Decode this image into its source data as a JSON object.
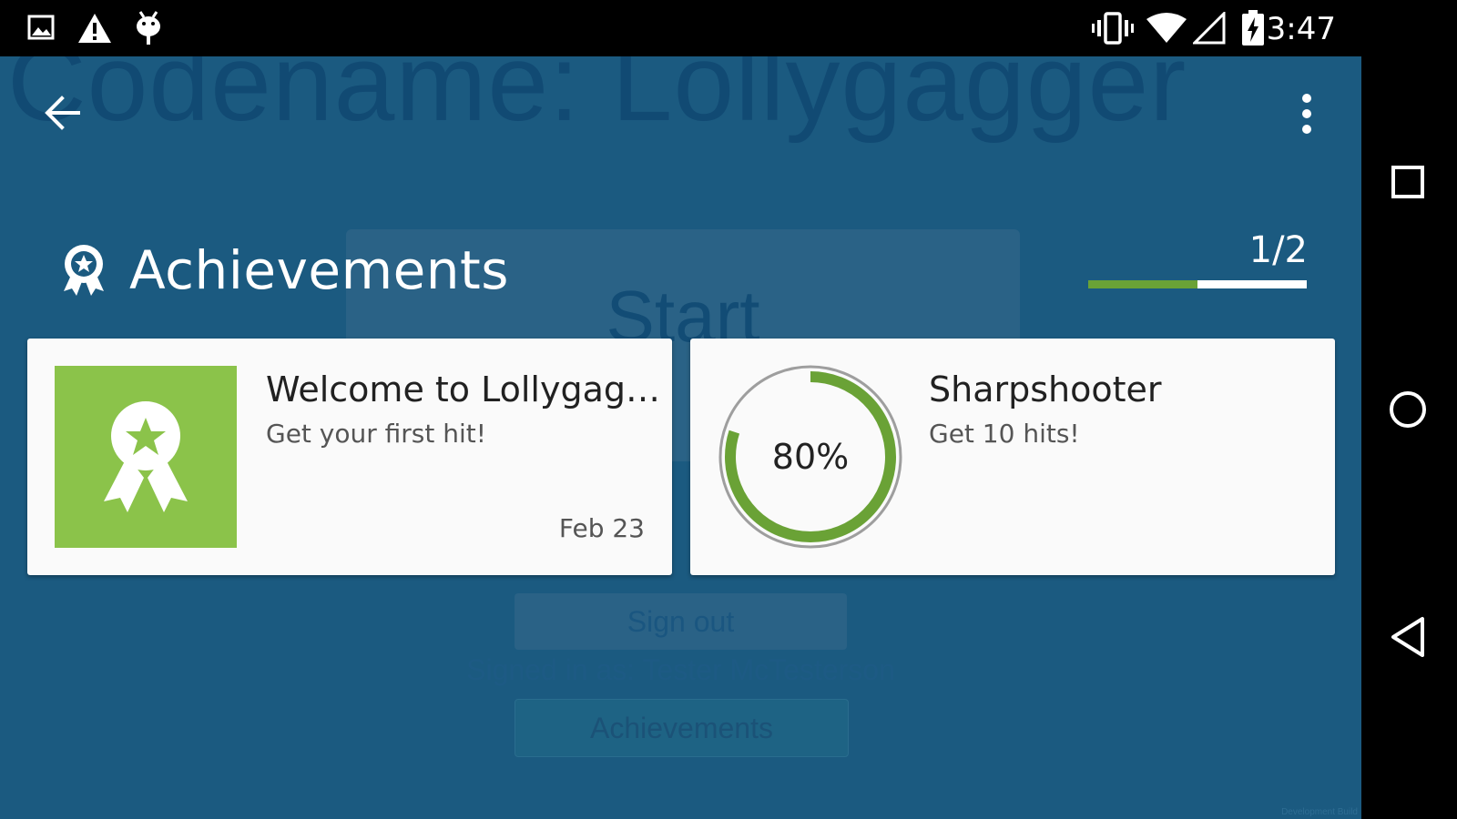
{
  "status_bar": {
    "time": "3:47",
    "left_icons": [
      "image-icon",
      "warning-icon",
      "android-debug-icon"
    ],
    "right_icons": [
      "vibrate-icon",
      "wifi-icon",
      "signal-icon",
      "battery-charging-icon"
    ]
  },
  "background": {
    "app_title": "Codename: Lollygagger",
    "start_label": "Start",
    "signout_label": "Sign out",
    "signed_in_text": "Signed in as: Tester McTesterson",
    "achievements_label": "Achievements",
    "dev_build": "Development Build"
  },
  "overlay": {
    "title": "Achievements",
    "progress_text": "1/2",
    "progress_fraction": 0.5,
    "icons": {
      "back": "back-arrow-icon",
      "menu": "overflow-menu-icon",
      "header": "award-icon"
    }
  },
  "achievements": [
    {
      "title": "Welcome to Lollygag…",
      "description": "Get your first hit!",
      "date": "Feb 23",
      "unlocked": true
    },
    {
      "title": "Sharpshooter",
      "description": "Get 10 hits!",
      "progress_label": "80%",
      "progress_fraction": 0.8,
      "unlocked": false
    }
  ],
  "colors": {
    "accent_green": "#8bc34a",
    "progress_green": "#6aa236",
    "overlay_bg": "#1b5a80"
  },
  "nav_bar": [
    "recents-icon",
    "home-icon",
    "back-icon"
  ]
}
